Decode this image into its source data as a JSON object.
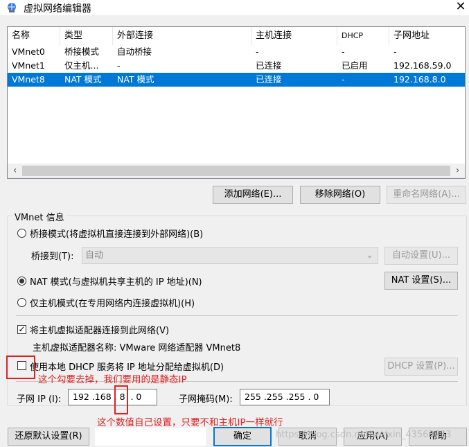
{
  "window": {
    "title": "虚拟网络编辑器",
    "icon": "network-app-icon",
    "close_glyph": "✕"
  },
  "table": {
    "columns": [
      "名称",
      "类型",
      "外部连接",
      "主机连接",
      "DHCP",
      "子网地址"
    ],
    "rows": [
      {
        "name": "VMnet0",
        "type": "桥接模式",
        "external": "自动桥接",
        "host": "-",
        "dhcp": "-",
        "subnet": "-"
      },
      {
        "name": "VMnet1",
        "type": "仅主机...",
        "external": "-",
        "host": "已连接",
        "dhcp": "已启用",
        "subnet": "192.168.59.0"
      },
      {
        "name": "VMnet8",
        "type": "NAT 模式",
        "external": "NAT 模式",
        "host": "已连接",
        "dhcp": "-",
        "subnet": "192.168.8.0"
      }
    ],
    "selected_row": "VMnet8",
    "scroll_left": "‹",
    "scroll_right": "›"
  },
  "list_buttons": {
    "add": "添加网络(E)...",
    "remove": "移除网络(O)",
    "rename": "重命名网络(A)..."
  },
  "vmnet_info": {
    "group_label": "VMnet 信息",
    "bridged_label": "桥接模式(将虚拟机直接连接到外部网络)(B)",
    "bridge_to_label": "桥接到(T):",
    "bridge_to_value": "自动",
    "auto_settings": "自动设置(U)...",
    "nat_label": "NAT 模式(与虚拟机共享主机的 IP 地址)(N)",
    "nat_settings": "NAT 设置(S)...",
    "hostonly_label": "仅主机模式(在专用网络内连接虚拟机)(H)",
    "connect_adapter_label": "将主机虚拟适配器连接到此网络(V)",
    "connect_adapter_checked": true,
    "adapter_name_label": "主机虚拟适配器名称: VMware 网络适配器 VMnet8",
    "dhcp_label": "使用本地 DHCP 服务将 IP 地址分配给虚拟机(D)",
    "dhcp_checked": false,
    "dhcp_settings": "DHCP 设置(P)...",
    "subnet_ip_label": "子网 IP (I):",
    "subnet_ip_value": "192 .168 . 8  . 0",
    "subnet_mask_label": "子网掩码(M):",
    "subnet_mask_value": "255 .255 .255 . 0"
  },
  "annotations": {
    "dhcp_note": "这个勾要去掉，我们要用的是静态IP",
    "ip_note": "这个数值自己设置，只要不和主机IP一样就行"
  },
  "bottom_buttons": {
    "restore": "还原默认设置(R)",
    "ok": "确定",
    "cancel": "取消",
    "apply": "应用(A)",
    "help": "帮助"
  },
  "watermark": "https://blog.csdn.net/weixin_43563733",
  "colors": {
    "selection": "#0078d7",
    "annotation_red": "#e02020"
  }
}
